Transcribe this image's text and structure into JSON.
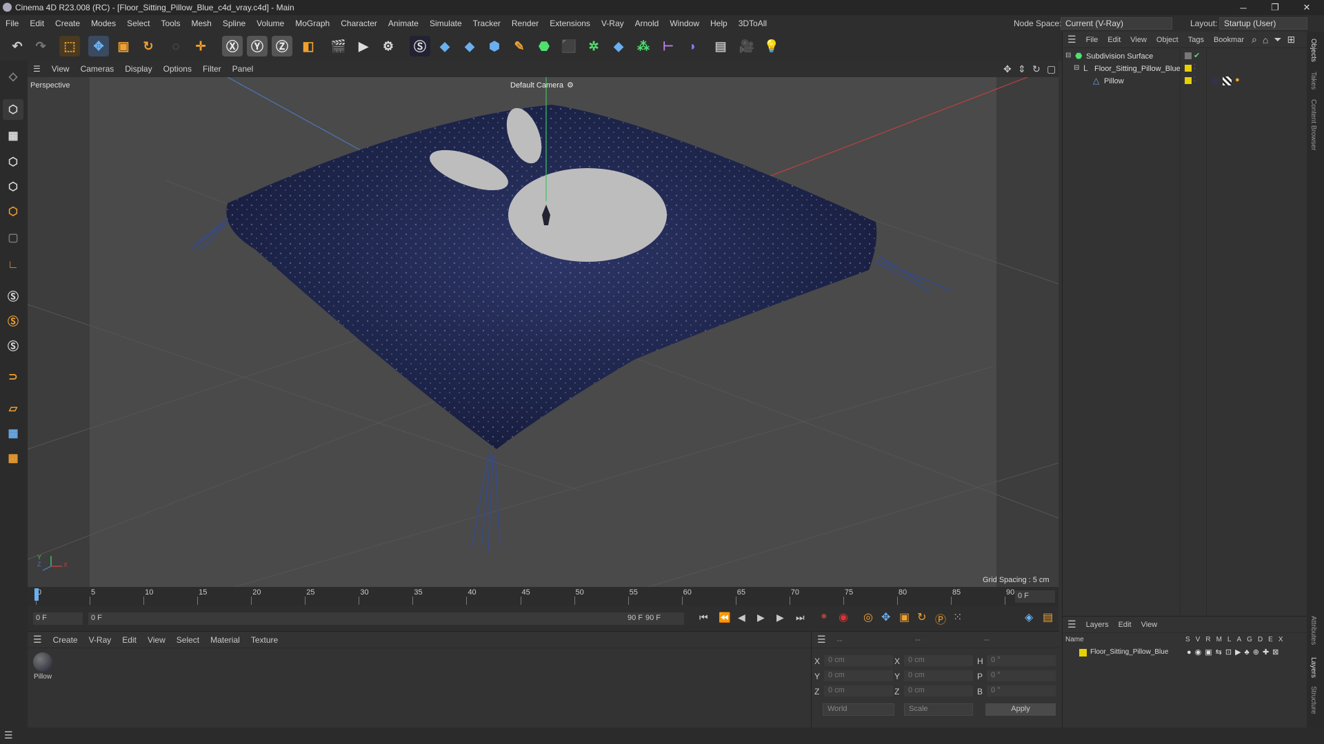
{
  "window": {
    "title": "Cinema 4D R23.008 (RC) - [Floor_Sitting_Pillow_Blue_c4d_vray.c4d] - Main"
  },
  "menubar": {
    "items": [
      "File",
      "Edit",
      "Create",
      "Modes",
      "Select",
      "Tools",
      "Mesh",
      "Spline",
      "Volume",
      "MoGraph",
      "Character",
      "Animate",
      "Simulate",
      "Tracker",
      "Render",
      "Extensions",
      "V-Ray",
      "Arnold",
      "Window",
      "Help",
      "3DToAll"
    ],
    "node_space_label": "Node Space:",
    "node_space_value": "Current (V-Ray)",
    "layout_label": "Layout:",
    "layout_value": "Startup (User)"
  },
  "viewport": {
    "menu": [
      "View",
      "Cameras",
      "Display",
      "Options",
      "Filter",
      "Panel"
    ],
    "label": "Perspective",
    "camera": "Default Camera",
    "grid_spacing": "Grid Spacing : 5 cm",
    "axis": {
      "x": "X",
      "y": "Y",
      "z": "Z"
    }
  },
  "timeline": {
    "ticks": [
      "0",
      "5",
      "10",
      "15",
      "20",
      "25",
      "30",
      "35",
      "40",
      "45",
      "50",
      "55",
      "60",
      "65",
      "70",
      "75",
      "80",
      "85",
      "90"
    ],
    "current_frame": "0 F"
  },
  "transport": {
    "start": "0 F",
    "range_start": "0 F",
    "range_end": "90 F",
    "end": "90 F"
  },
  "material_manager": {
    "menu": [
      "Create",
      "V-Ray",
      "Edit",
      "View",
      "Select",
      "Material",
      "Texture"
    ],
    "material_name": "Pillow"
  },
  "coordinates": {
    "header1": "--",
    "header2": "--",
    "header3": "--",
    "rows": [
      {
        "a": "X",
        "av": "0 cm",
        "b": "X",
        "bv": "0 cm",
        "c": "H",
        "cv": "0 °"
      },
      {
        "a": "Y",
        "av": "0 cm",
        "b": "Y",
        "bv": "0 cm",
        "c": "P",
        "cv": "0 °"
      },
      {
        "a": "Z",
        "av": "0 cm",
        "b": "Z",
        "bv": "0 cm",
        "c": "B",
        "cv": "0 °"
      }
    ],
    "mode": "World",
    "scale": "Scale",
    "apply": "Apply"
  },
  "object_manager": {
    "menu": [
      "File",
      "Edit",
      "View",
      "Object",
      "Tags",
      "Bookmar"
    ],
    "objects": [
      {
        "name": "Subdivision Surface"
      },
      {
        "name": "Floor_Sitting_Pillow_Blue"
      },
      {
        "name": "Pillow"
      }
    ]
  },
  "layer_manager": {
    "menu": [
      "Layers",
      "Edit",
      "View"
    ],
    "header_name": "Name",
    "flags": [
      "S",
      "V",
      "R",
      "M",
      "L",
      "A",
      "G",
      "D",
      "E",
      "X"
    ],
    "layer": "Floor_Sitting_Pillow_Blue"
  },
  "right_tabs": [
    "Objects",
    "Takes",
    "Content Browser",
    "Attributes",
    "Layers",
    "Structure"
  ],
  "colors": {
    "accent": "#f0a030",
    "pillow": "#222a55",
    "layer_yellow": "#e8d000"
  }
}
